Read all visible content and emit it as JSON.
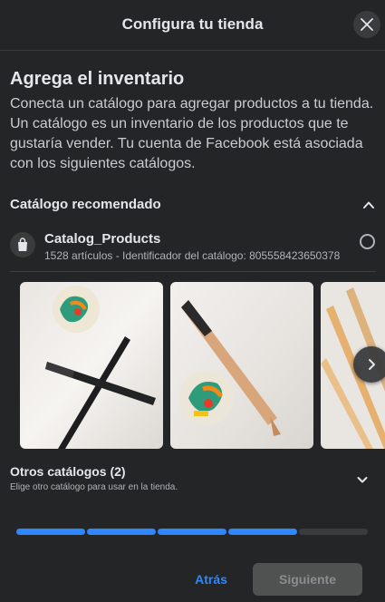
{
  "header": {
    "title": "Configura tu tienda",
    "close_icon": "close-icon"
  },
  "section": {
    "title": "Agrega el inventario",
    "description": "Conecta un catálogo para agregar productos a tu tienda. Un catálogo es un inventario de los productos que te gustaría vender. Tu cuenta de Facebook está asociada con los siguientes catálogos."
  },
  "recommended": {
    "label": "Catálogo recomendado",
    "toggle_icon": "chevron-up-icon",
    "catalog": {
      "icon": "shopping-bag-icon",
      "name": "Catalog_Products",
      "meta": "1528 artículos - Identificador del catálogo: 805558423650378",
      "selected": false
    }
  },
  "carousel": {
    "images": [
      {
        "label": "black-pens-with-sticker"
      },
      {
        "label": "wooden-pen-with-sticker"
      },
      {
        "label": "wooden-pencils"
      }
    ],
    "next_icon": "chevron-right-icon"
  },
  "other": {
    "title": "Otros catálogos (2)",
    "subtitle": "Elige otro catálogo para usar en la tienda.",
    "toggle_icon": "chevron-down-icon"
  },
  "progress": {
    "total_steps": 5,
    "completed_steps": 4,
    "active_color": "#2d88ff",
    "inactive_color": "#3a3b3c"
  },
  "footer": {
    "back_label": "Atrás",
    "next_label": "Siguiente"
  }
}
